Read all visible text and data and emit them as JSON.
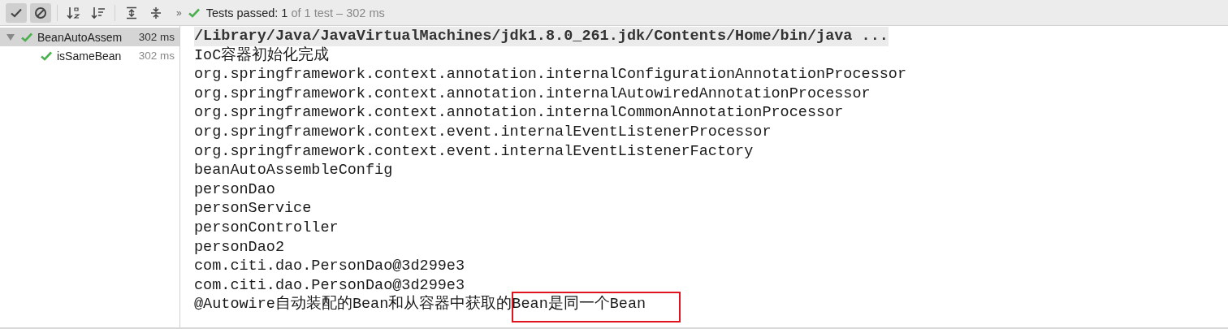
{
  "toolbar": {
    "buttons": [
      {
        "kind": "check",
        "pressed": true
      },
      {
        "kind": "cancel",
        "pressed": true
      },
      {
        "kind": "sort-alpha",
        "pressed": false
      },
      {
        "kind": "sort-duration",
        "pressed": false
      },
      {
        "kind": "expand",
        "pressed": false
      },
      {
        "kind": "collapse",
        "pressed": false
      }
    ],
    "more": "»",
    "status": {
      "passed": "Tests passed: 1",
      "rest": "of 1 test – 302 ms"
    }
  },
  "tree": [
    {
      "name": "BeanAutoAssem",
      "time": "302 ms",
      "passed": true,
      "expanded": true,
      "selected": true,
      "children": [
        {
          "name": "isSameBean",
          "time": "302 ms",
          "passed": true,
          "selected": false
        }
      ]
    }
  ],
  "console": {
    "lines": [
      {
        "kind": "command",
        "text": "/Library/Java/JavaVirtualMachines/jdk1.8.0_261.jdk/Contents/Home/bin/java ..."
      },
      {
        "kind": "output",
        "text": "IoC容器初始化完成"
      },
      {
        "kind": "output",
        "text": "org.springframework.context.annotation.internalConfigurationAnnotationProcessor"
      },
      {
        "kind": "output",
        "text": "org.springframework.context.annotation.internalAutowiredAnnotationProcessor"
      },
      {
        "kind": "output",
        "text": "org.springframework.context.annotation.internalCommonAnnotationProcessor"
      },
      {
        "kind": "output",
        "text": "org.springframework.context.event.internalEventListenerProcessor"
      },
      {
        "kind": "output",
        "text": "org.springframework.context.event.internalEventListenerFactory"
      },
      {
        "kind": "output",
        "text": "beanAutoAssembleConfig"
      },
      {
        "kind": "output",
        "text": "personDao"
      },
      {
        "kind": "output",
        "text": "personService"
      },
      {
        "kind": "output",
        "text": "personController"
      },
      {
        "kind": "output",
        "text": "personDao2"
      },
      {
        "kind": "output",
        "text": "com.citi.dao.PersonDao@3d299e3"
      },
      {
        "kind": "output",
        "text": "com.citi.dao.PersonDao@3d299e3"
      },
      {
        "kind": "output",
        "text": "@Autowire自动装配的Bean和从容器中获取的Bean是同一个Bean",
        "highlighted": true
      }
    ]
  }
}
